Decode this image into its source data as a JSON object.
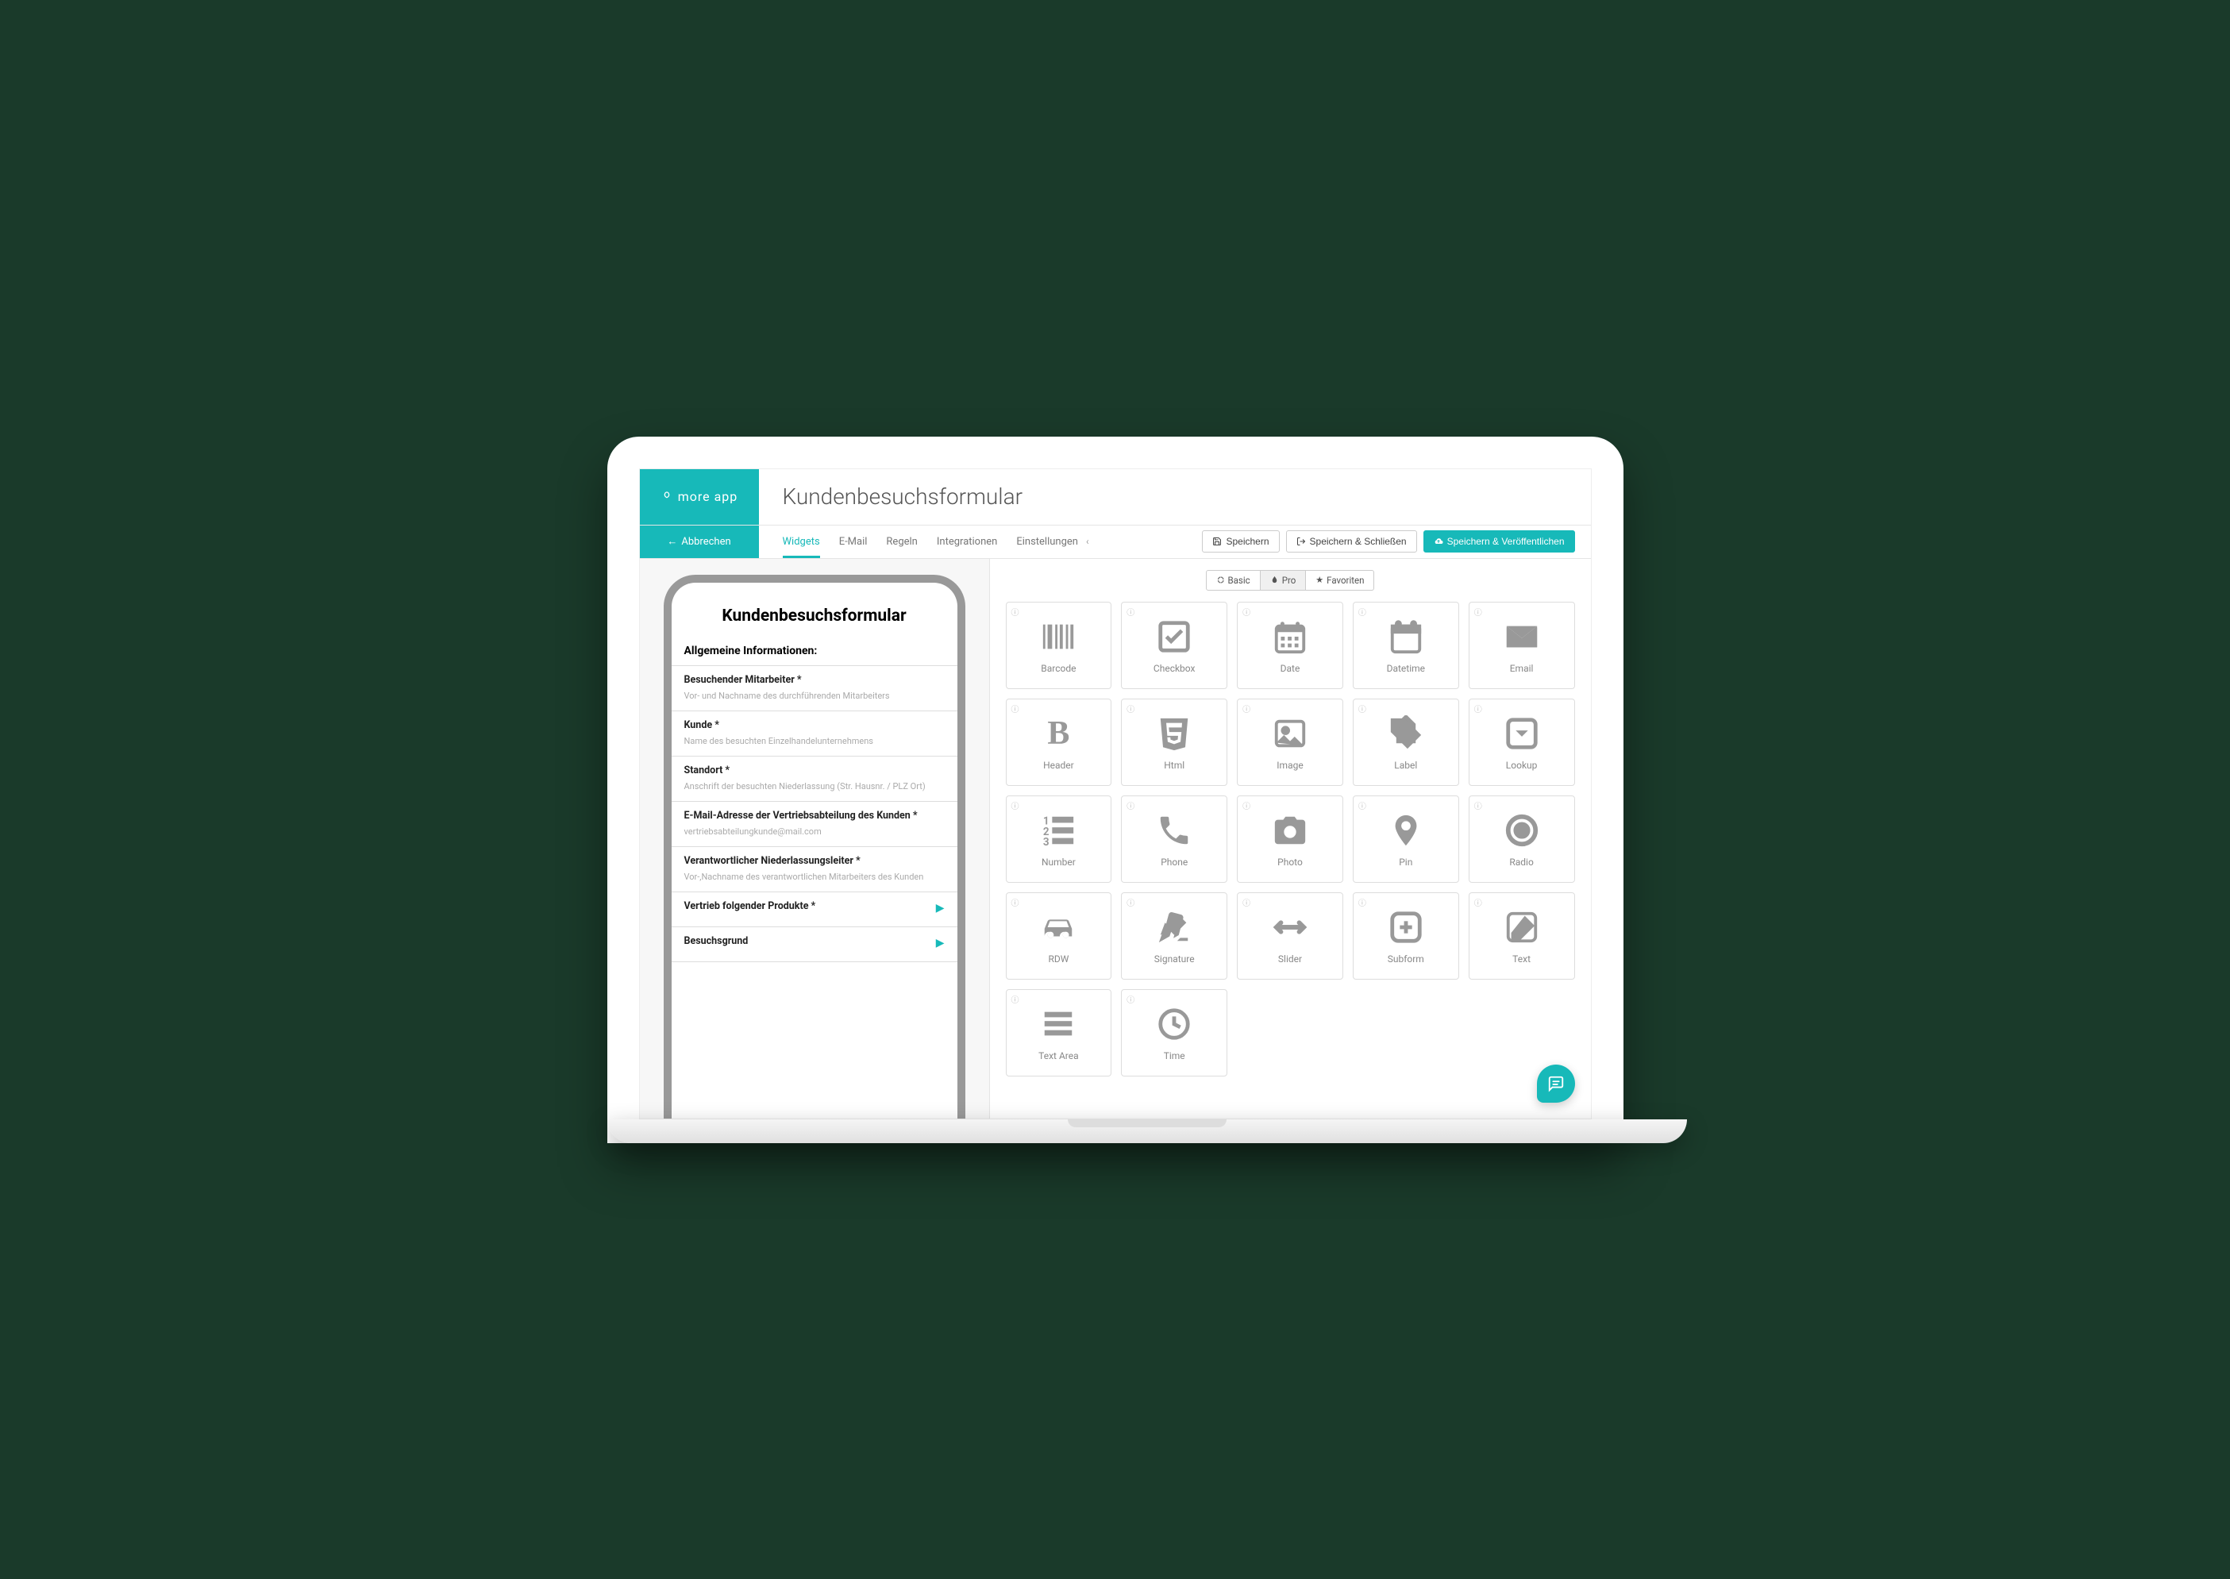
{
  "brand": "more app",
  "page_title": "Kundenbesuchsformular",
  "cancel_label": "Abbrechen",
  "tabs": [
    "Widgets",
    "E-Mail",
    "Regeln",
    "Integrationen",
    "Einstellungen"
  ],
  "active_tab": 0,
  "buttons": {
    "save": "Speichern",
    "save_close": "Speichern & Schließen",
    "save_publish": "Speichern & Veröffentlichen"
  },
  "filters": {
    "basic": "Basic",
    "pro": "Pro",
    "favorites": "Favoriten"
  },
  "active_filter": 1,
  "form": {
    "title": "Kundenbesuchsformular",
    "section": "Allgemeine Informationen:",
    "fields": [
      {
        "label": "Besuchender Mitarbeiter *",
        "hint": "Vor- und Nachname des durchführenden Mitarbeiters",
        "arrow": false
      },
      {
        "label": "Kunde *",
        "hint": "Name des besuchten Einzelhandelunternehmens",
        "arrow": false
      },
      {
        "label": "Standort *",
        "hint": "Anschrift der besuchten Niederlassung (Str. Hausnr. / PLZ Ort)",
        "arrow": false
      },
      {
        "label": "E-Mail-Adresse der Vertriebsabteilung des Kunden *",
        "hint": "vertriebsabteilungkunde@mail.com",
        "arrow": false
      },
      {
        "label": "Verantwortlicher Niederlassungsleiter *",
        "hint": "Vor-,Nachname des verantwortlichen Mitarbeiters des Kunden",
        "arrow": false
      },
      {
        "label": "Vertrieb folgender Produkte *",
        "hint": "",
        "arrow": true
      },
      {
        "label": "Besuchsgrund",
        "hint": "",
        "arrow": true
      }
    ]
  },
  "widgets": [
    {
      "label": "Barcode",
      "icon": "barcode"
    },
    {
      "label": "Checkbox",
      "icon": "checkbox"
    },
    {
      "label": "Date",
      "icon": "date"
    },
    {
      "label": "Datetime",
      "icon": "datetime"
    },
    {
      "label": "Email",
      "icon": "email"
    },
    {
      "label": "Header",
      "icon": "header"
    },
    {
      "label": "Html",
      "icon": "html"
    },
    {
      "label": "Image",
      "icon": "image"
    },
    {
      "label": "Label",
      "icon": "label"
    },
    {
      "label": "Lookup",
      "icon": "lookup"
    },
    {
      "label": "Number",
      "icon": "number"
    },
    {
      "label": "Phone",
      "icon": "phone"
    },
    {
      "label": "Photo",
      "icon": "photo"
    },
    {
      "label": "Pin",
      "icon": "pin"
    },
    {
      "label": "Radio",
      "icon": "radio"
    },
    {
      "label": "RDW",
      "icon": "rdw"
    },
    {
      "label": "Signature",
      "icon": "signature"
    },
    {
      "label": "Slider",
      "icon": "slider"
    },
    {
      "label": "Subform",
      "icon": "subform"
    },
    {
      "label": "Text",
      "icon": "text"
    },
    {
      "label": "Text Area",
      "icon": "textarea"
    },
    {
      "label": "Time",
      "icon": "time"
    }
  ]
}
